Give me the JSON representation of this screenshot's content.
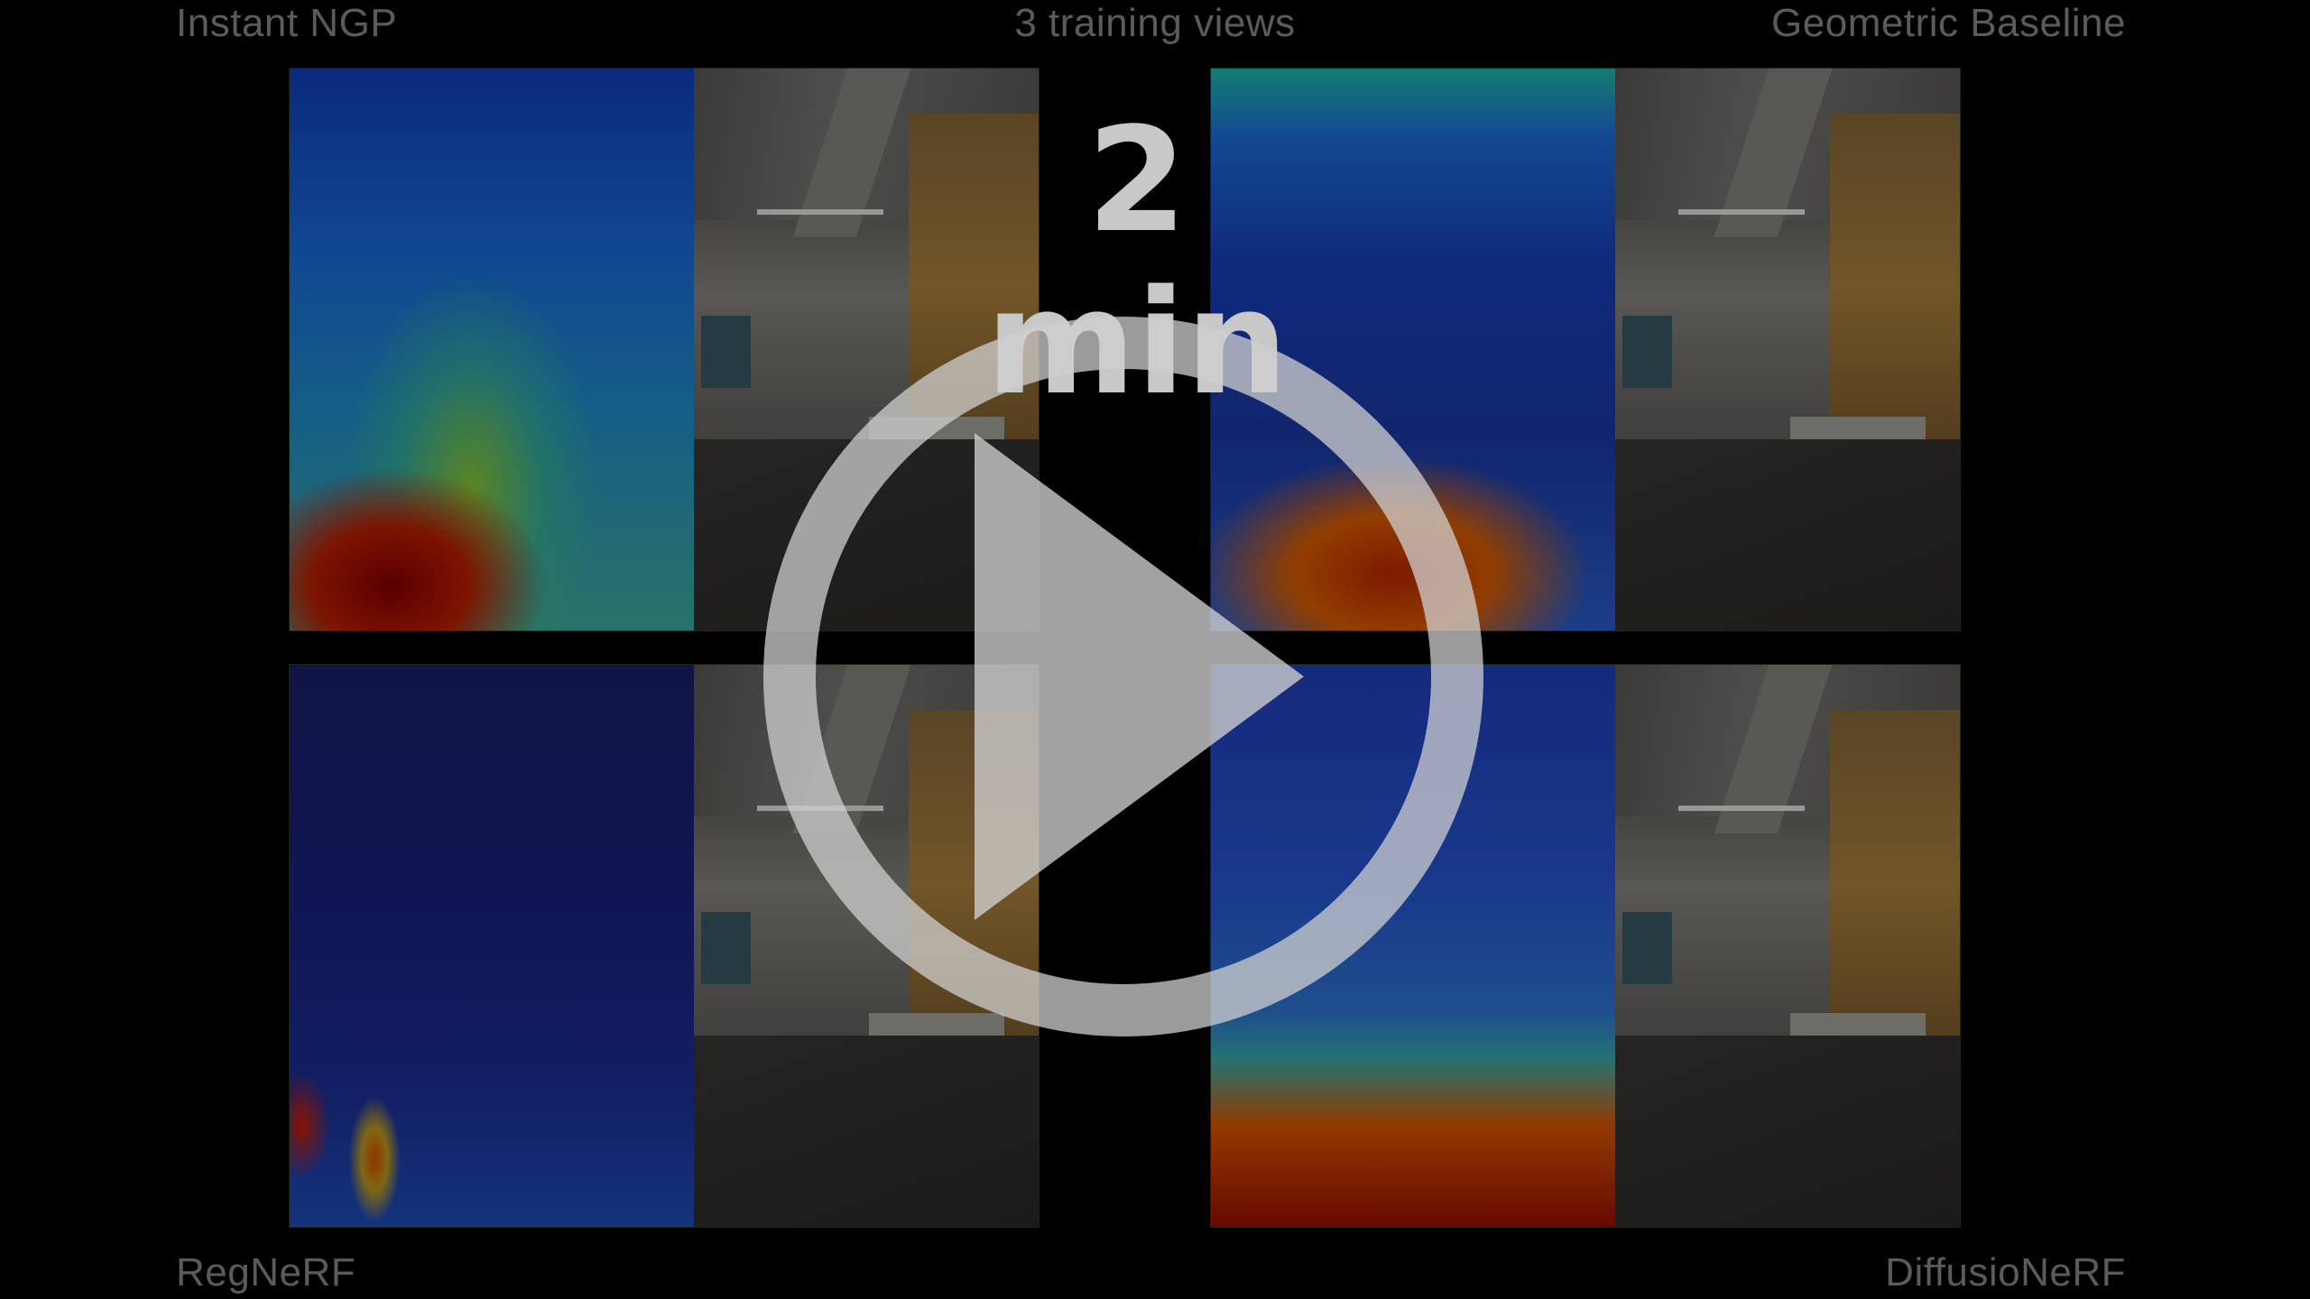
{
  "labels": {
    "top_left": "Instant NGP",
    "top_center": "3 training views",
    "top_right": "Geometric Baseline",
    "bottom_left": "RegNeRF",
    "bottom_right": "DiffusioNeRF"
  },
  "video": {
    "duration": "2 min"
  },
  "icons": {
    "play": "play-circle-icon"
  },
  "colors": {
    "background": "#000000",
    "label_text": "#8c8c8c",
    "overlay_icon": "#cfcfcf"
  }
}
